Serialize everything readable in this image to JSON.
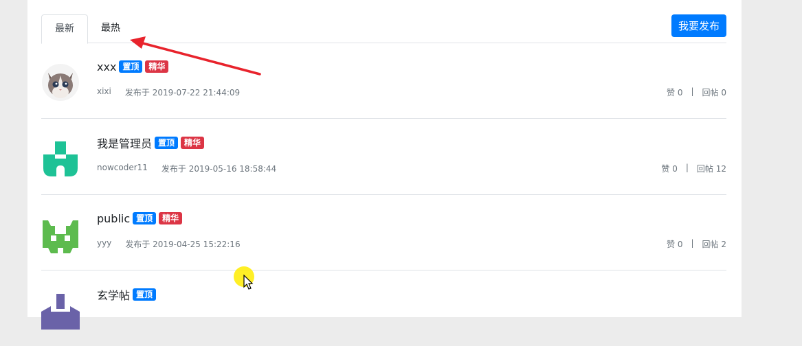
{
  "tabs": [
    {
      "label": "最新",
      "active": true
    },
    {
      "label": "最热",
      "active": false
    }
  ],
  "publish_button": "我要发布",
  "colors": {
    "primary": "#007bff",
    "danger": "#dc3545",
    "annotation_arrow": "#e8232c"
  },
  "posts": [
    {
      "title": "xxx",
      "badges": [
        "置顶",
        "精华"
      ],
      "author": "xixi",
      "published": "发布于 2019-07-22 21:44:09",
      "likes": "赞 0",
      "replies": "回帖 0",
      "avatar": "cat-avatar"
    },
    {
      "title": "我是管理员",
      "badges": [
        "置顶",
        "精华"
      ],
      "author": "nowcoder11",
      "published": "发布于 2019-05-16 18:58:44",
      "likes": "赞 0",
      "replies": "回帖 12",
      "avatar": "green-identicon-avatar"
    },
    {
      "title": "public",
      "badges": [
        "置顶",
        "精华"
      ],
      "author": "yyy",
      "published": "发布于 2019-04-25 15:22:16",
      "likes": "赞 0",
      "replies": "回帖 2",
      "avatar": "lime-identicon-avatar"
    },
    {
      "title": "玄学帖",
      "badges": [
        "置顶"
      ],
      "avatar": "purple-identicon-avatar"
    }
  ],
  "separator": "|"
}
